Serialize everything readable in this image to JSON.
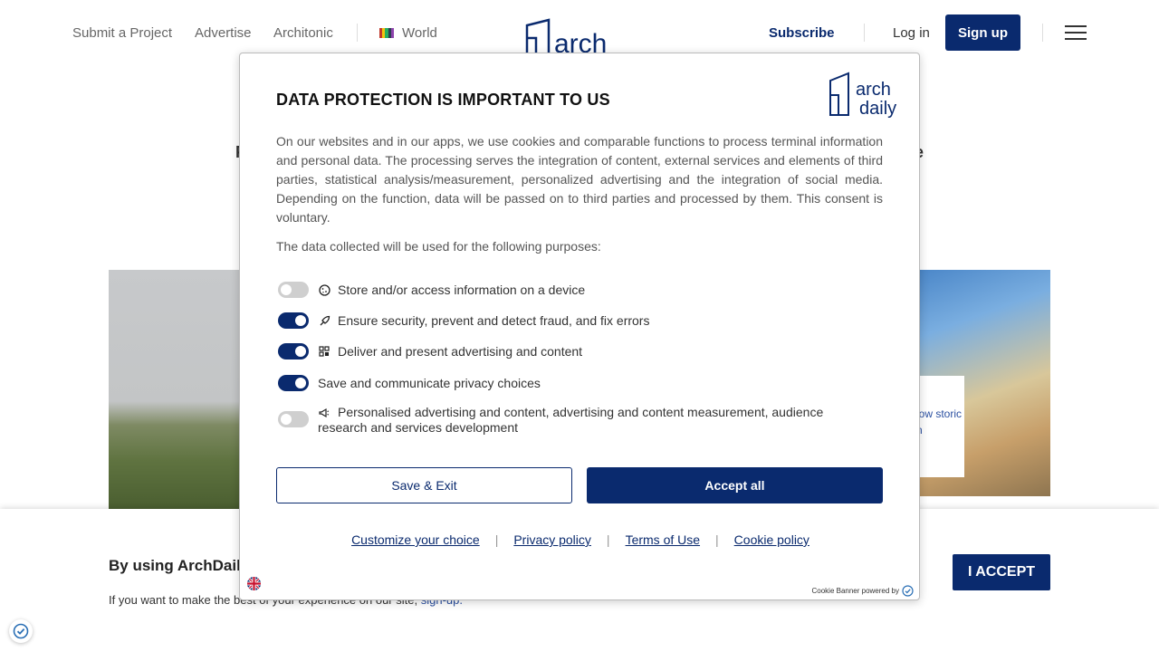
{
  "nav": {
    "submit": "Submit a Project",
    "advertise": "Advertise",
    "architonic": "Architonic",
    "world": "World",
    "subscribe": "Subscribe",
    "login": "Log in",
    "signup": "Sign up",
    "logo_text": "arch"
  },
  "background": {
    "card_text": "low storic n",
    "fragment_left": "F",
    "fragment_right": "e"
  },
  "modal": {
    "title": "DATA PROTECTION IS IMPORTANT TO US",
    "logo_line1": "arch",
    "logo_line2": "daily",
    "body": "On our websites and in our apps, we use cookies and comparable functions to process terminal information and personal data. The processing serves the integration of content, external services and elements of third parties, statistical analysis/measurement, personalized advertising and the integration of social media. Depending on the function, data will be passed on to third parties and processed by them. This consent is voluntary.",
    "purposes_intro": "The data collected will be used for the following purposes:",
    "purposes": [
      {
        "label": "Store and/or access information on a device",
        "enabled": false,
        "icon": "cookie-icon"
      },
      {
        "label": "Ensure security, prevent and detect fraud, and fix errors",
        "enabled": true,
        "icon": "rocket-icon"
      },
      {
        "label": "Deliver and present advertising and content",
        "enabled": true,
        "icon": "grid-icon"
      },
      {
        "label": "Save and communicate privacy choices",
        "enabled": true,
        "icon": ""
      },
      {
        "label": "Personalised advertising and content, advertising and content measurement, audience research and services development",
        "enabled": false,
        "icon": "megaphone-icon"
      }
    ],
    "save_exit": "Save & Exit",
    "accept_all": "Accept all",
    "links": {
      "customize": "Customize your choice",
      "privacy": "Privacy policy",
      "terms": "Terms of Use",
      "cookie": "Cookie policy"
    },
    "powered_by": "Cookie Banner powered by"
  },
  "notice": {
    "title": "By using ArchDaily",
    "subtitle": "If you want to make the best of your experience on our site,",
    "signup_link": "sign-up.",
    "accept": "I ACCEPT"
  },
  "colors": {
    "brand": "#0a2a6e",
    "toggle_off": "#cfcfcf",
    "link": "#2a4fa0"
  }
}
